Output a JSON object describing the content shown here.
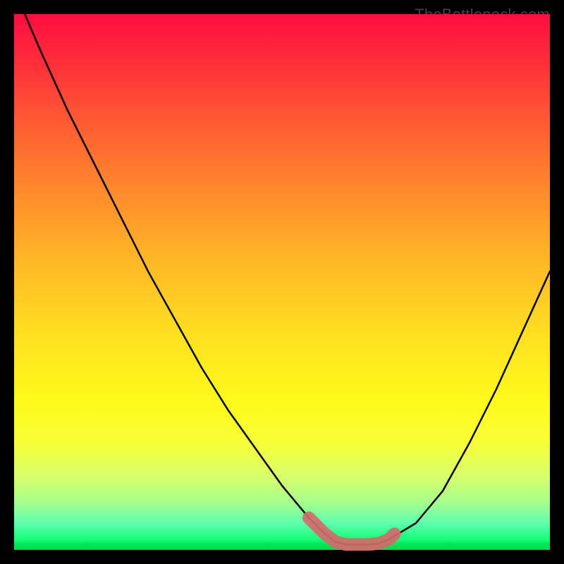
{
  "attribution": "TheBottleneck.com",
  "colors": {
    "background": "#000000",
    "gradient_top": "#ff0d3f",
    "gradient_mid": "#ffe020",
    "gradient_bottom": "#00e85a",
    "curve_stroke": "#000000",
    "thick_overlay": "#d46a6a",
    "attribution_text": "#444444"
  },
  "chart_data": {
    "type": "line",
    "title": "",
    "xlabel": "",
    "ylabel": "",
    "xlim": [
      0,
      100
    ],
    "ylim": [
      0,
      100
    ],
    "grid": false,
    "legend": false,
    "series": [
      {
        "name": "bottleneck-curve",
        "x": [
          2,
          5,
          10,
          15,
          20,
          25,
          30,
          35,
          40,
          45,
          50,
          55,
          58,
          60,
          62,
          64,
          66,
          68,
          70,
          75,
          80,
          85,
          90,
          95,
          100
        ],
        "values": [
          100,
          93,
          82,
          72,
          62,
          52,
          43,
          34,
          26,
          19,
          12,
          6,
          3,
          1.5,
          1,
          1,
          1,
          1.2,
          2,
          5,
          11,
          20,
          30,
          41,
          52
        ]
      }
    ],
    "highlight_segment": {
      "name": "optimal-zone-overlay",
      "x": [
        55,
        58,
        60,
        62,
        64,
        66,
        68,
        70,
        71
      ],
      "values": [
        6,
        3,
        1.5,
        1,
        1,
        1,
        1.2,
        2,
        3
      ]
    }
  }
}
